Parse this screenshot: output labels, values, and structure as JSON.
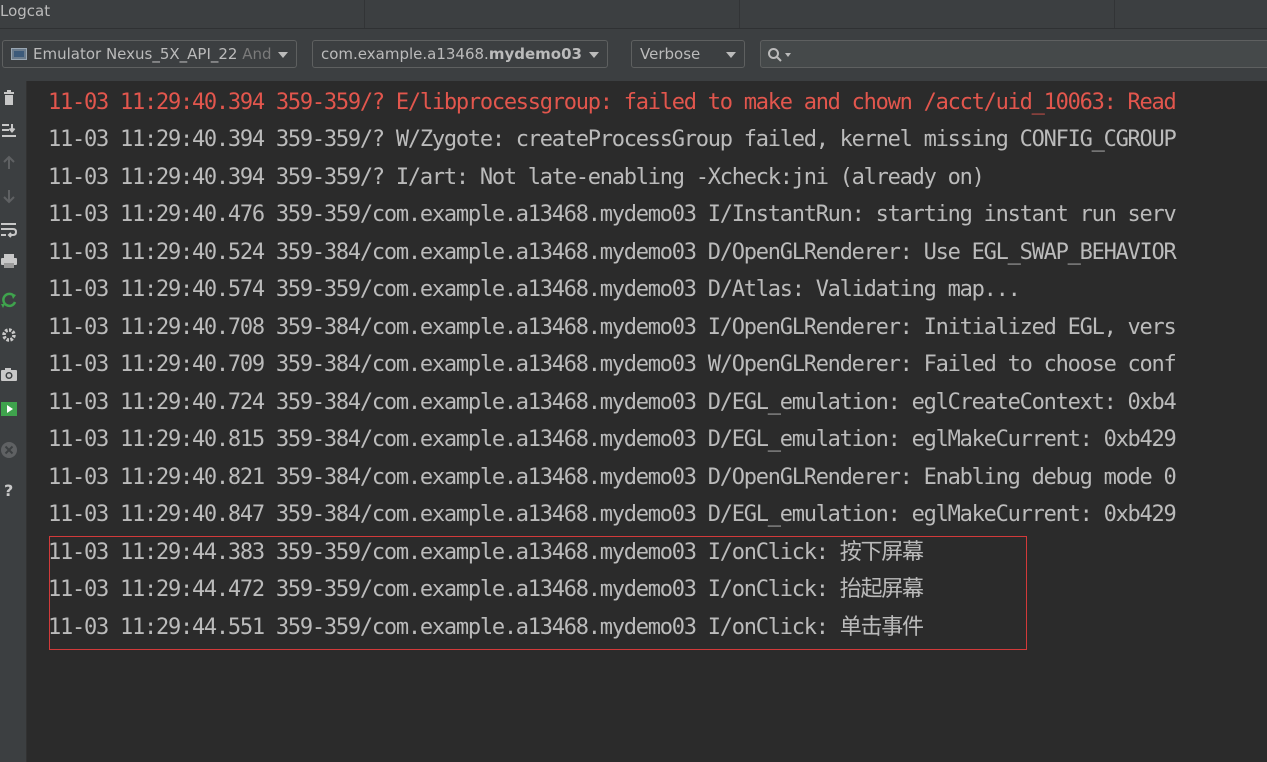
{
  "window": {
    "title": "Logcat"
  },
  "toolbar": {
    "device_name": "Emulator Nexus_5X_API_22",
    "device_suffix": "Andi",
    "process_prefix": "com.example.a13468.",
    "process_bold": "mydemo03",
    "process_suffix": "(",
    "log_level": "Verbose",
    "search_value": ""
  },
  "sidebar": {
    "icons": [
      "trash-icon",
      "scroll-to-end-icon",
      "up-arrow-icon",
      "down-arrow-icon",
      "soft-wrap-icon",
      "print-icon",
      "restart-icon",
      "settings-icon",
      "screenshot-icon",
      "screen-record-icon",
      "close-icon",
      "help-icon"
    ]
  },
  "log": {
    "lines": [
      "11-03 11:29:40.394 359-359/? E/libprocessgroup: failed to make and chown /acct/uid_10063: Read",
      "11-03 11:29:40.394 359-359/? W/Zygote: createProcessGroup failed, kernel missing CONFIG_CGROUP",
      "11-03 11:29:40.394 359-359/? I/art: Not late-enabling -Xcheck:jni (already on)",
      "11-03 11:29:40.476 359-359/com.example.a13468.mydemo03 I/InstantRun: starting instant run serv",
      "11-03 11:29:40.524 359-384/com.example.a13468.mydemo03 D/OpenGLRenderer: Use EGL_SWAP_BEHAVIOR",
      "11-03 11:29:40.574 359-359/com.example.a13468.mydemo03 D/Atlas: Validating map...",
      "11-03 11:29:40.708 359-384/com.example.a13468.mydemo03 I/OpenGLRenderer: Initialized EGL, vers",
      "11-03 11:29:40.709 359-384/com.example.a13468.mydemo03 W/OpenGLRenderer: Failed to choose conf",
      "11-03 11:29:40.724 359-384/com.example.a13468.mydemo03 D/EGL_emulation: eglCreateContext: 0xb4",
      "11-03 11:29:40.815 359-384/com.example.a13468.mydemo03 D/EGL_emulation: eglMakeCurrent: 0xb429",
      "11-03 11:29:40.821 359-384/com.example.a13468.mydemo03 D/OpenGLRenderer: Enabling debug mode 0",
      "11-03 11:29:40.847 359-384/com.example.a13468.mydemo03 D/EGL_emulation: eglMakeCurrent: 0xb429",
      "11-03 11:29:44.383 359-359/com.example.a13468.mydemo03 I/onClick: ",
      "11-03 11:29:44.472 359-359/com.example.a13468.mydemo03 I/onClick: ",
      "11-03 11:29:44.551 359-359/com.example.a13468.mydemo03 I/onClick: "
    ],
    "cjk_messages": [
      "按下屏幕",
      "抬起屏幕",
      "单击事件"
    ]
  },
  "colors": {
    "error_text": "#e2564d",
    "normal_text": "#bbbbbb",
    "highlight_border": "#d23a3a",
    "accent_green": "#3fa34d"
  }
}
